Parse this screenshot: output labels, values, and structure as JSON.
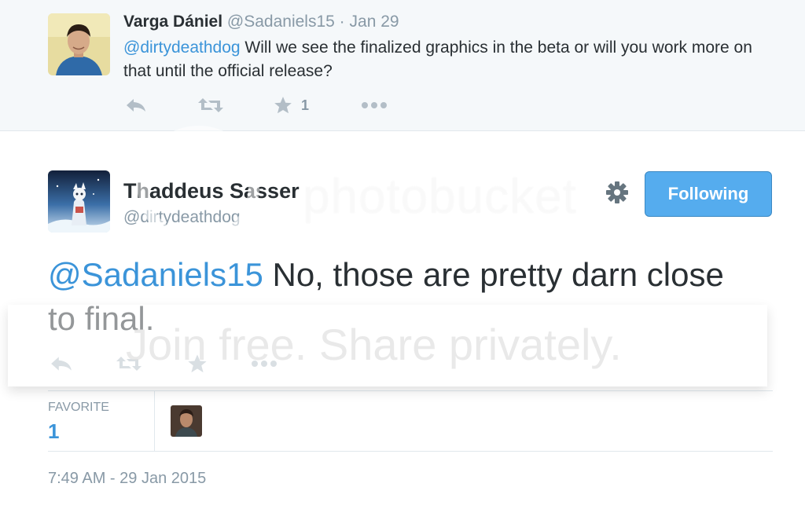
{
  "reply_tweet": {
    "name": "Varga Dániel",
    "handle": "@Sadaniels15",
    "separator": "·",
    "date": "Jan 29",
    "mention": "@dirtydeathdog",
    "text": " Will we see the finalized graphics in the beta or will you work more on that until the official release?",
    "favorite_count": "1",
    "action_icons": [
      "reply-icon",
      "retweet-icon",
      "star-icon",
      "more-icon"
    ]
  },
  "main_tweet": {
    "name": "Thaddeus Sasser",
    "handle": "@dirtydeathdog",
    "follow_label": "Following",
    "mention": "@Sadaniels15",
    "text": " No, those are pretty darn close to final.",
    "action_icons": [
      "reply-icon",
      "retweet-icon",
      "star-icon",
      "more-icon"
    ]
  },
  "stats": {
    "favorite_label": "FAVORITE",
    "favorite_count": "1"
  },
  "timestamp": "7:49 AM - 29 Jan 2015",
  "watermark": {
    "logo_text": "photobucket",
    "tagline": "Join free. Share privately."
  },
  "colors": {
    "link": "#3b94d9",
    "button": "#55acee",
    "muted": "#8899a6",
    "text": "#292f33",
    "reply_background": "#f5f8fa"
  }
}
